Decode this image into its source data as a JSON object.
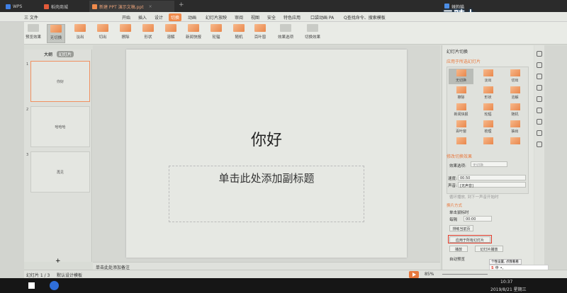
{
  "tabs": [
    {
      "label": "WPS"
    },
    {
      "label": "稻壳商城"
    },
    {
      "label": "新建 PPT 演示文稿.ppt"
    }
  ],
  "user_name": "辣狗猫",
  "brand": "云骑士",
  "menu": {
    "file": "三 文件",
    "items": [
      "开始",
      "插入",
      "设计",
      "切换",
      "动画",
      "幻灯片放映",
      "审阅",
      "视图",
      "安全",
      "特色应用",
      "口袋动画 PA"
    ],
    "selected": "切换",
    "search": "Q查找命令、搜索模板"
  },
  "ribbon": {
    "preview": "预览效果",
    "effects": [
      "无切换",
      "淡出",
      "切出",
      "擦除",
      "形状",
      "溶解",
      "新闻快报",
      "轮辐",
      "随机",
      "百叶窗"
    ],
    "options": "效果选项",
    "switch_effect": "切换效果"
  },
  "left_panel": {
    "outline_tab": "大纲",
    "slides_tab": "幻灯片",
    "slides": [
      {
        "num": "1",
        "text": "你好"
      },
      {
        "num": "2",
        "text": "哈哈哈"
      },
      {
        "num": "3",
        "text": "再见"
      }
    ],
    "add": "+"
  },
  "slide": {
    "title": "你好",
    "subtitle": "单击此处添加副标题"
  },
  "notes_placeholder": "单击此处添加备注",
  "panel": {
    "header": "幻灯片切换",
    "apply_selected": "应用于所选幻灯片",
    "effects": [
      "无切换",
      "淡出",
      "切出",
      "擦除",
      "形状",
      "溶解",
      "新闻快报",
      "轮辐",
      "随机",
      "百叶窗",
      "梳理",
      "抽出"
    ],
    "modify_title": "修改切换效果",
    "effect_option_label": "效果选项:",
    "effect_option_value": "无切换",
    "speed_label": "速度:",
    "speed_value": "00.50",
    "sound_label": "声音:",
    "sound_value": "[无声音]",
    "loop_label": "循环播放, 到下一声音开始时",
    "advance_title": "换片方式",
    "on_click": "单击鼠标时",
    "every_label": "每隔",
    "every_value": "00:00",
    "rehearse": "排练当前页",
    "apply_all": "应用于所有幻灯片",
    "play": "播放",
    "show": "幻灯片播放",
    "autopreview": "自动预览"
  },
  "status": {
    "slide_count": "幻灯片 1 / 3",
    "template": "默认设计模板",
    "zoom": "85%"
  },
  "ime_tip": "个性设置, 点我看看",
  "taskbar": {
    "time": "10:37",
    "date": "2019/8/21 星期三"
  },
  "colors": {
    "accent": "#e8783d",
    "highlight_box": "#e23a2a"
  }
}
